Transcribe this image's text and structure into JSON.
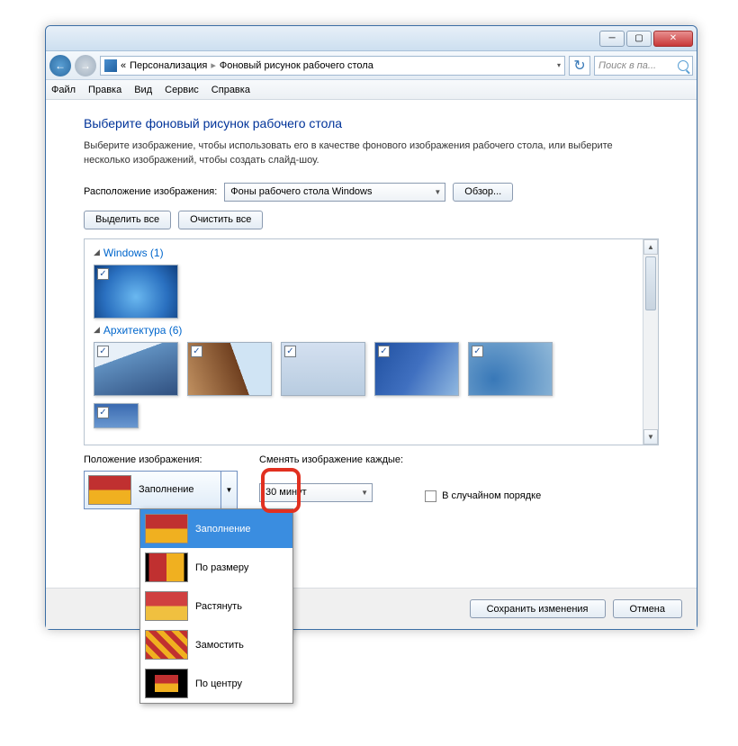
{
  "window": {
    "breadcrumb": {
      "prev": "Персонализация",
      "current": "Фоновый рисунок рабочего стола"
    },
    "search_placeholder": "Поиск в па..."
  },
  "menu": {
    "file": "Файл",
    "edit": "Правка",
    "view": "Вид",
    "tools": "Сервис",
    "help": "Справка"
  },
  "content": {
    "heading": "Выберите фоновый рисунок рабочего стола",
    "sub": "Выберите изображение, чтобы использовать его в качестве фонового изображения рабочего стола, или выберите несколько изображений, чтобы создать слайд-шоу.",
    "loc_label": "Расположение изображения:",
    "loc_value": "Фоны рабочего стола Windows",
    "browse": "Обзор...",
    "select_all": "Выделить все",
    "clear_all": "Очистить все",
    "cat1": "Windows (1)",
    "cat2": "Архитектура (6)",
    "pos_label": "Положение изображения:",
    "pos_value": "Заполнение",
    "change_label": "Сменять изображение каждые:",
    "change_value": "30 минут",
    "random": "В случайном порядке",
    "save": "Сохранить изменения",
    "cancel": "Отмена"
  },
  "dropdown": {
    "fill": "Заполнение",
    "fit": "По размеру",
    "stretch": "Растянуть",
    "tile": "Замостить",
    "center": "По центру"
  }
}
